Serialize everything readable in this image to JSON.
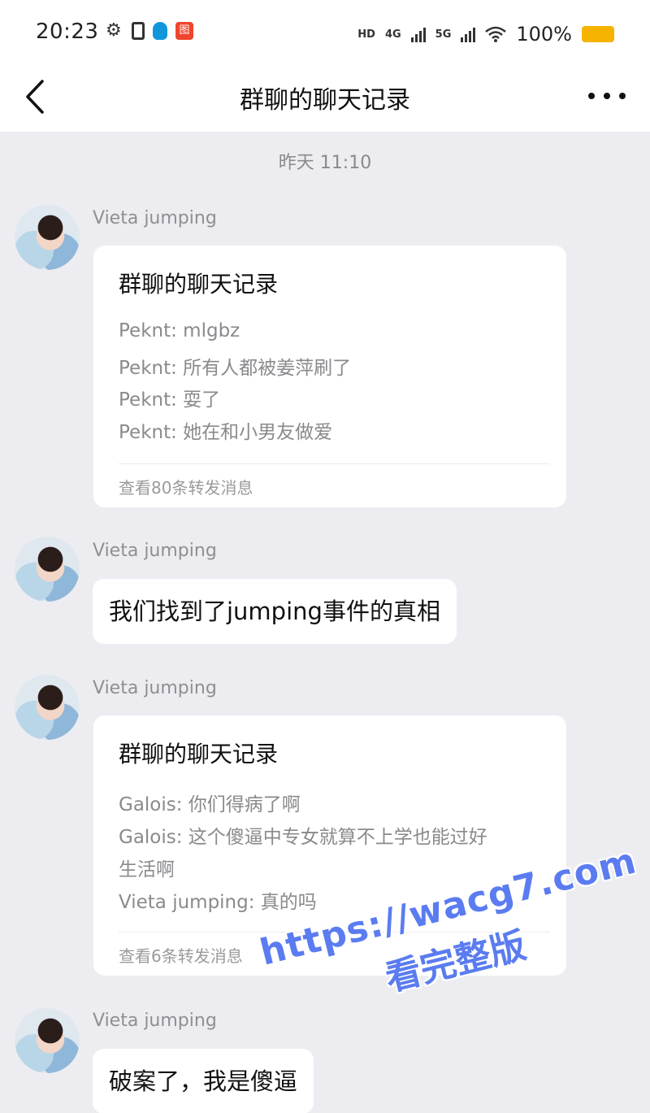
{
  "status_bar": {
    "time": "20:23",
    "network_labels": [
      "HD",
      "4G",
      "5G"
    ],
    "battery": "100%",
    "battery_color": "#f6b400"
  },
  "nav": {
    "title": "群聊的聊天记录",
    "back_icon": "chevron-left-icon",
    "more_icon": "more-horizontal-icon"
  },
  "chat": {
    "timestamp": "昨天 11:10",
    "messages": [
      {
        "sender": "Vieta jumping",
        "type": "forward_card",
        "title": "群聊的聊天记录",
        "lines": [
          "Peknt: mlgbz",
          "Peknt: 所有人都被姜萍刷了",
          "Peknt: 耍了",
          "Peknt: 她在和小男友做爱"
        ],
        "footer": "查看80条转发消息"
      },
      {
        "sender": "Vieta jumping",
        "type": "text",
        "text": "我们找到了jumping事件的真相"
      },
      {
        "sender": "Vieta jumping",
        "type": "forward_card",
        "title": "群聊的聊天记录",
        "lines": [
          "Galois: 你们得病了啊",
          "Galois: 这个傻逼中专女就算不上学也能过好",
          "生活啊",
          "Vieta jumping: 真的吗"
        ],
        "footer": "查看6条转发消息"
      },
      {
        "sender": "Vieta jumping",
        "type": "text",
        "text": "破案了，我是傻逼"
      }
    ]
  },
  "watermark": {
    "url": "https://wacg7.com",
    "text": "看完整版",
    "color": "#5b7cf0"
  }
}
